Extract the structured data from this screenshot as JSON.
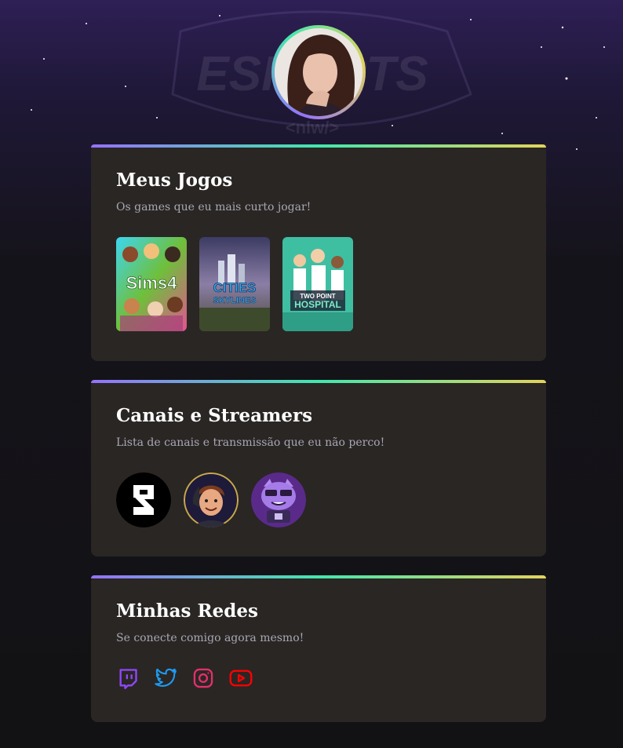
{
  "profile": {
    "avatar_icon": "profile-avatar-photo"
  },
  "background": {
    "logo_text": "ESPORTS",
    "logo_subtext": "<nlw/>"
  },
  "games_section": {
    "title": "Meus Jogos",
    "subtitle": "Os games que eu mais curto jogar!",
    "games": [
      {
        "name": "The Sims 4",
        "art_text": "Sims4"
      },
      {
        "name": "Cities: Skylines",
        "art_text_1": "CITIES",
        "art_text_2": "SKYLINES"
      },
      {
        "name": "Two Point Hospital",
        "art_text_1": "TWO POINT",
        "art_text_2": "HOSPITAL"
      }
    ]
  },
  "channels_section": {
    "title": "Canais e Streamers",
    "subtitle": "Lista de canais e transmissão que eu não perco!",
    "channels": [
      {
        "icon": "rocketseat-logo-icon"
      },
      {
        "icon": "streamer-avatar-icon"
      },
      {
        "icon": "purple-mascot-avatar-icon"
      }
    ]
  },
  "socials_section": {
    "title": "Minhas Redes",
    "subtitle": "Se conecte comigo agora mesmo!",
    "networks": [
      {
        "icon": "twitch-icon",
        "color": "#9147ff"
      },
      {
        "icon": "twitter-icon",
        "color": "#1d9bf0"
      },
      {
        "icon": "instagram-icon",
        "color": "#e1306c"
      },
      {
        "icon": "youtube-icon",
        "color": "#ff0000"
      }
    ]
  },
  "colors": {
    "gradient": [
      "#9572fc",
      "#43e7ad",
      "#e2d45c"
    ],
    "card_bg": "#2a2624",
    "title": "#ffffff",
    "subtitle": "#a8a8b3"
  }
}
